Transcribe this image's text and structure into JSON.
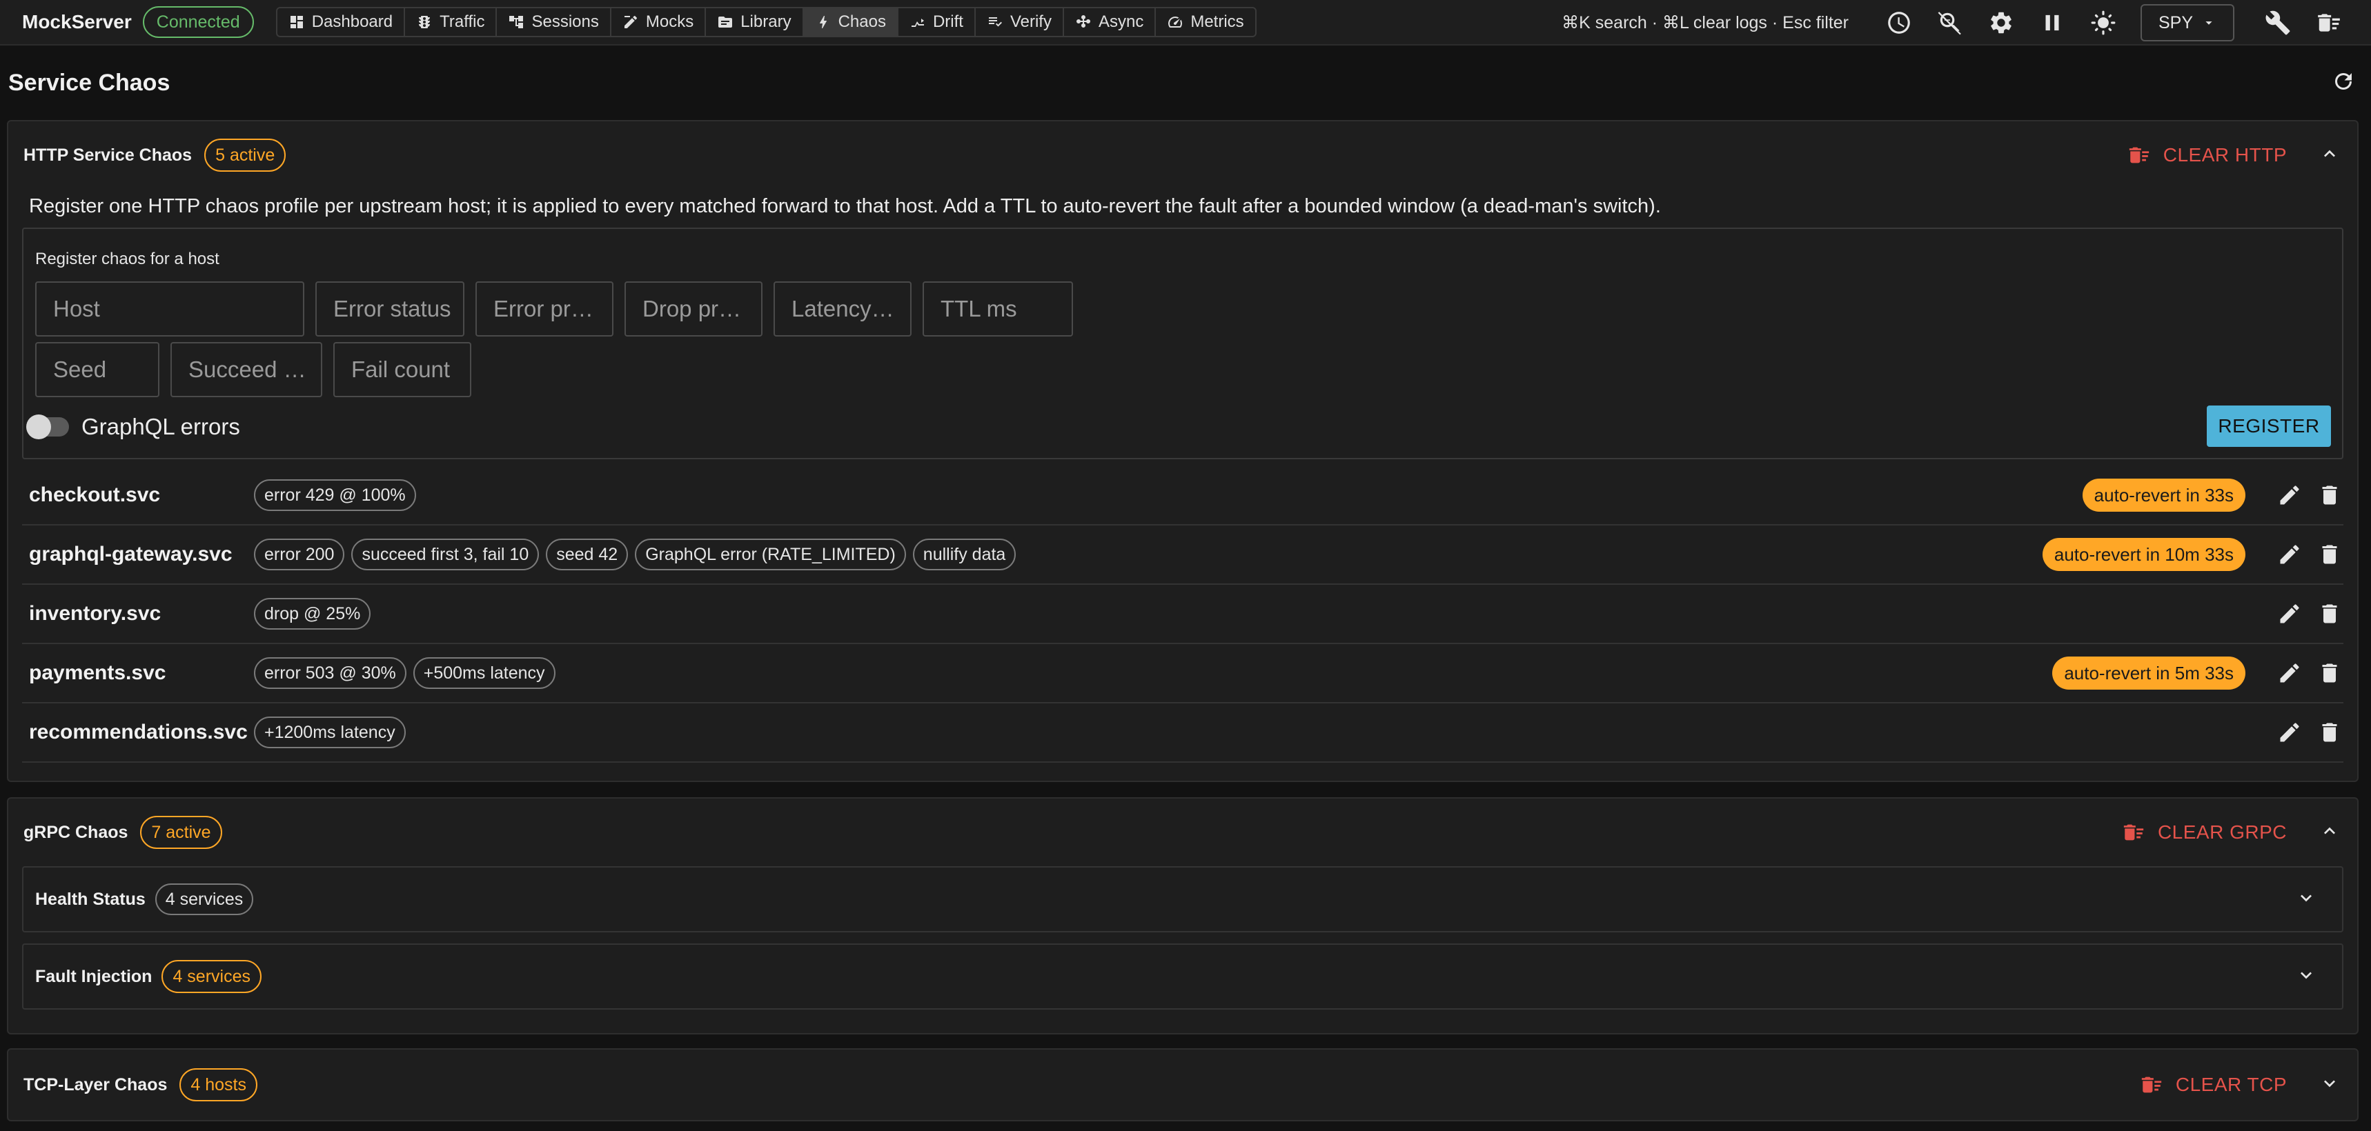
{
  "app": {
    "title": "MockServer",
    "status": "Connected"
  },
  "nav": [
    {
      "id": "dashboard",
      "label": "Dashboard",
      "icon": "dashboard-icon",
      "active": false
    },
    {
      "id": "traffic",
      "label": "Traffic",
      "icon": "traffic-icon",
      "active": false
    },
    {
      "id": "sessions",
      "label": "Sessions",
      "icon": "sessions-icon",
      "active": false
    },
    {
      "id": "mocks",
      "label": "Mocks",
      "icon": "mocks-icon",
      "active": false
    },
    {
      "id": "library",
      "label": "Library",
      "icon": "library-icon",
      "active": false
    },
    {
      "id": "chaos",
      "label": "Chaos",
      "icon": "bolt-icon",
      "active": true
    },
    {
      "id": "drift",
      "label": "Drift",
      "icon": "drift-icon",
      "active": false
    },
    {
      "id": "verify",
      "label": "Verify",
      "icon": "verify-icon",
      "active": false
    },
    {
      "id": "async",
      "label": "Async",
      "icon": "async-icon",
      "active": false
    },
    {
      "id": "metrics",
      "label": "Metrics",
      "icon": "speed-icon",
      "active": false
    }
  ],
  "toolbar": {
    "shortcuts": "⌘K search · ⌘L clear logs · Esc filter",
    "mode": "SPY"
  },
  "page": {
    "title": "Service Chaos"
  },
  "http": {
    "title": "HTTP Service Chaos",
    "badge": "5 active",
    "clear_label": "CLEAR HTTP",
    "description": "Register one HTTP chaos profile per upstream host; it is applied to every matched forward to that host. Add a TTL to auto-revert the fault after a bounded window (a dead-man's switch).",
    "form": {
      "label": "Register chaos for a host",
      "fields": {
        "host": "Host",
        "error_status": "Error status",
        "error_prob": "Error pr…",
        "drop_prob": "Drop pr…",
        "latency": "Latency…",
        "ttl": "TTL ms",
        "seed": "Seed",
        "succeed": "Succeed …",
        "fail_count": "Fail count"
      },
      "graphql_label": "GraphQL errors",
      "graphql_enabled": false,
      "register_label": "REGISTER"
    },
    "rows": [
      {
        "host": "checkout.svc",
        "tags": [
          "error 429 @ 100%"
        ],
        "revert": "auto-revert in 33s"
      },
      {
        "host": "graphql-gateway.svc",
        "tags": [
          "error 200",
          "succeed first 3, fail 10",
          "seed 42",
          "GraphQL error (RATE_LIMITED)",
          "nullify data"
        ],
        "revert": "auto-revert in 10m 33s"
      },
      {
        "host": "inventory.svc",
        "tags": [
          "drop @ 25%"
        ],
        "revert": ""
      },
      {
        "host": "payments.svc",
        "tags": [
          "error 503 @ 30%",
          "+500ms latency"
        ],
        "revert": "auto-revert in 5m 33s"
      },
      {
        "host": "recommendations.svc",
        "tags": [
          "+1200ms latency"
        ],
        "revert": ""
      }
    ]
  },
  "grpc": {
    "title": "gRPC Chaos",
    "badge": "7 active",
    "clear_label": "CLEAR GRPC",
    "health": {
      "title": "Health Status",
      "badge": "4 services"
    },
    "fault": {
      "title": "Fault Injection",
      "badge": "4 services"
    }
  },
  "tcp": {
    "title": "TCP-Layer Chaos",
    "badge": "4 hosts",
    "clear_label": "CLEAR TCP"
  },
  "colors": {
    "accent": "#4fb3d9",
    "warning": "#ffa726",
    "danger": "#e5534b",
    "success": "#66bb6a"
  }
}
